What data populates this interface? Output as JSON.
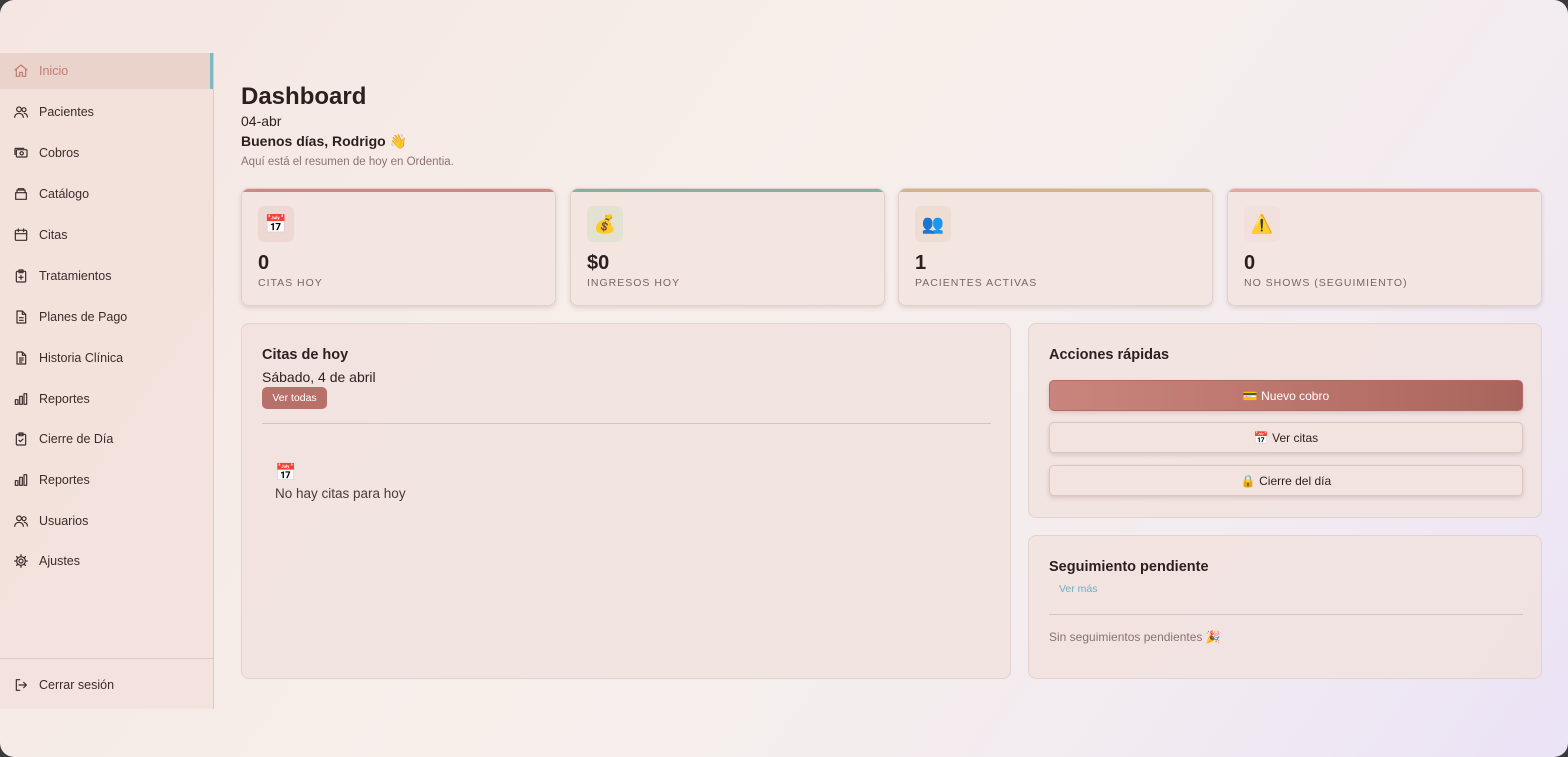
{
  "sidebar": {
    "items": [
      {
        "label": "Inicio",
        "icon": "home-icon"
      },
      {
        "label": "Pacientes",
        "icon": "users-icon"
      },
      {
        "label": "Cobros",
        "icon": "cash-icon"
      },
      {
        "label": "Catálogo",
        "icon": "box-icon"
      },
      {
        "label": "Citas",
        "icon": "calendar-icon"
      },
      {
        "label": "Tratamientos",
        "icon": "clipboard-plus-icon"
      },
      {
        "label": "Planes de Pago",
        "icon": "document-icon"
      },
      {
        "label": "Historia Clínica",
        "icon": "document-lines-icon"
      },
      {
        "label": "Reportes",
        "icon": "bar-chart-icon"
      },
      {
        "label": "Cierre de Día",
        "icon": "clipboard-check-icon"
      },
      {
        "label": "Reportes",
        "icon": "bar-chart-icon"
      },
      {
        "label": "Usuarios",
        "icon": "users-icon"
      },
      {
        "label": "Ajustes",
        "icon": "gear-icon"
      }
    ],
    "active": "Inicio",
    "logout_label": "Cerrar sesión"
  },
  "header": {
    "title": "Dashboard",
    "date": "04-abr",
    "greeting": "Buenos días, Rodrigo 👋",
    "subtitle": "Aquí está el resumen de hoy en Ordentia."
  },
  "stats": [
    {
      "icon": "📅",
      "value": "0",
      "label": "CITAS HOY",
      "accent": "#c98a86"
    },
    {
      "icon": "💰",
      "value": "$0",
      "label": "INGRESOS HOY",
      "accent": "#7fb3a2"
    },
    {
      "icon": "👥",
      "value": "1",
      "label": "PACIENTES ACTIVAS",
      "accent": "#d2b48c"
    },
    {
      "icon": "⚠️",
      "value": "0",
      "label": "NO SHOWS (SEGUIMIENTO)",
      "accent": "#e3a7a3"
    }
  ],
  "citas": {
    "title": "Citas de hoy",
    "date": "Sábado, 4 de abril",
    "button": "Ver todas",
    "empty_icon": "📅",
    "empty_text": "No hay citas para hoy"
  },
  "acciones": {
    "title": "Acciones rápidas",
    "buttons": [
      "💳 Nuevo cobro",
      "📅 Ver citas",
      "🔒 Cierre del día"
    ]
  },
  "seguimiento": {
    "title": "Seguimiento pendiente",
    "link": "Ver más",
    "empty_text": "Sin seguimientos pendientes 🎉"
  },
  "colors": {
    "brand": "#b8706a",
    "active_indicator": "#7fb9c4",
    "link": "#6fb0bd"
  }
}
